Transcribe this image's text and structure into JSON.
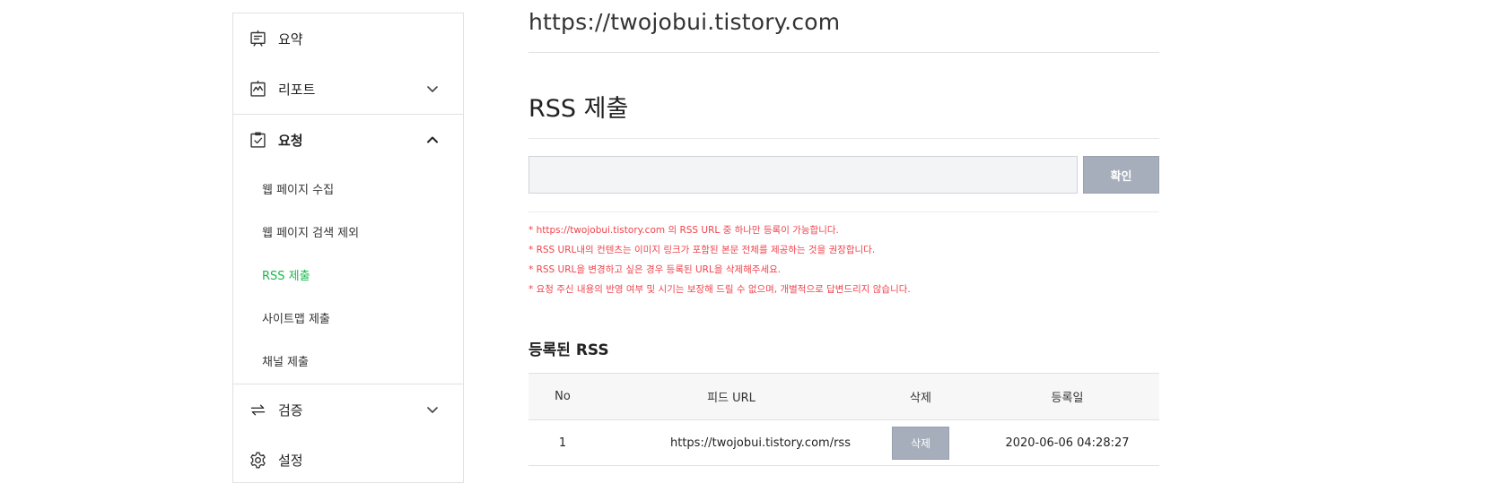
{
  "sidebar": {
    "items": [
      {
        "label": "요약",
        "icon": "summary-icon"
      },
      {
        "label": "리포트",
        "icon": "report-icon"
      },
      {
        "label": "요청",
        "icon": "request-icon"
      },
      {
        "label": "검증",
        "icon": "verify-icon"
      },
      {
        "label": "설정",
        "icon": "settings-icon"
      }
    ],
    "request_sub_items": [
      {
        "label": "웹 페이지 수집"
      },
      {
        "label": "웹 페이지 검색 제외"
      },
      {
        "label": "RSS 제출"
      },
      {
        "label": "사이트맵 제출"
      },
      {
        "label": "채널 제출"
      }
    ],
    "active_sub_item": "RSS 제출",
    "active_color": "#19b84c"
  },
  "main": {
    "site_url": "https://twojobui.tistory.com",
    "page_title": "RSS 제출",
    "input": {
      "value": "",
      "placeholder": ""
    },
    "confirm_label": "확인",
    "notes": [
      "* https://twojobui.tistory.com 의 RSS URL 중 하나만 등록이 가능합니다.",
      "* RSS URL내의 컨텐츠는 이미지 링크가 포함된 본문 전체를 제공하는 것을 권장합니다.",
      "* RSS URL을 변경하고 싶은 경우 등록된 URL을 삭제해주세요.",
      "* 요청 주신 내용의 반영 여부 및 시기는 보장해 드릴 수 없으며, 개별적으로 답변드리지 않습니다."
    ],
    "note_color": "#f0444d",
    "registered_title": "등록된 RSS",
    "table": {
      "headers": [
        "No",
        "피드 URL",
        "삭제",
        "등록일"
      ],
      "rows": [
        {
          "no": "1",
          "url": "https://twojobui.tistory.com/rss",
          "delete_label": "삭제",
          "date": "2020-06-06 04:28:27"
        }
      ]
    }
  }
}
